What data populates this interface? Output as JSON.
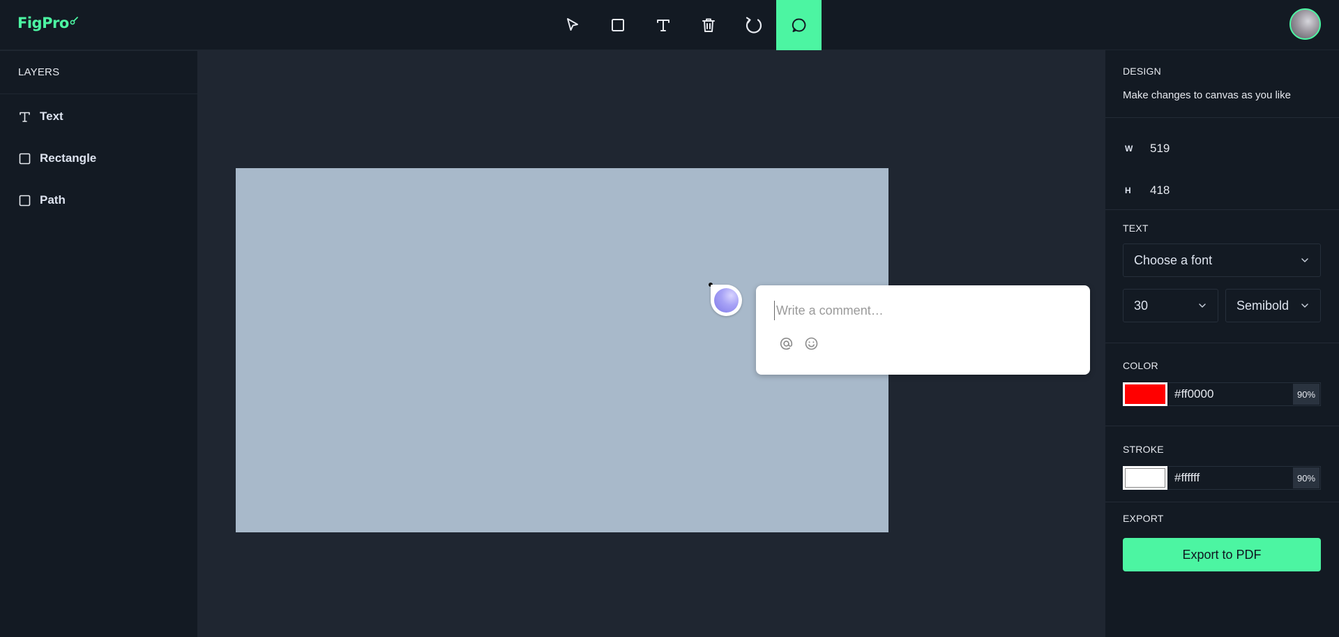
{
  "app": {
    "logo_text": "FigPro"
  },
  "toolbar": {
    "tools": [
      {
        "name": "select",
        "icon": "cursor-icon"
      },
      {
        "name": "rectangle",
        "icon": "square-icon"
      },
      {
        "name": "text",
        "icon": "text-icon"
      },
      {
        "name": "delete",
        "icon": "trash-icon"
      },
      {
        "name": "reset",
        "icon": "refresh-icon"
      },
      {
        "name": "comment",
        "icon": "comment-icon",
        "active": true
      }
    ],
    "accent_color": "#4cf5a2"
  },
  "layers": {
    "title": "LAYERS",
    "items": [
      {
        "label": "Text",
        "icon": "text-icon"
      },
      {
        "label": "Rectangle",
        "icon": "square-icon"
      },
      {
        "label": "Path",
        "icon": "square-icon"
      }
    ]
  },
  "canvas": {
    "rectangle_color": "#a8b9ca",
    "comment": {
      "placeholder": "Write a comment…"
    }
  },
  "design": {
    "title": "DESIGN",
    "subtitle": "Make changes to canvas as you like",
    "width_label": "W",
    "width_value": "519",
    "height_label": "H",
    "height_value": "418",
    "text": {
      "title": "TEXT",
      "font_placeholder": "Choose a font",
      "font_size": "30",
      "font_weight": "Semibold"
    },
    "color": {
      "title": "COLOR",
      "hex": "#ff0000",
      "opacity": "90%"
    },
    "stroke": {
      "title": "STROKE",
      "hex": "#ffffff",
      "opacity": "90%"
    },
    "export": {
      "title": "EXPORT",
      "button_label": "Export to PDF"
    }
  }
}
